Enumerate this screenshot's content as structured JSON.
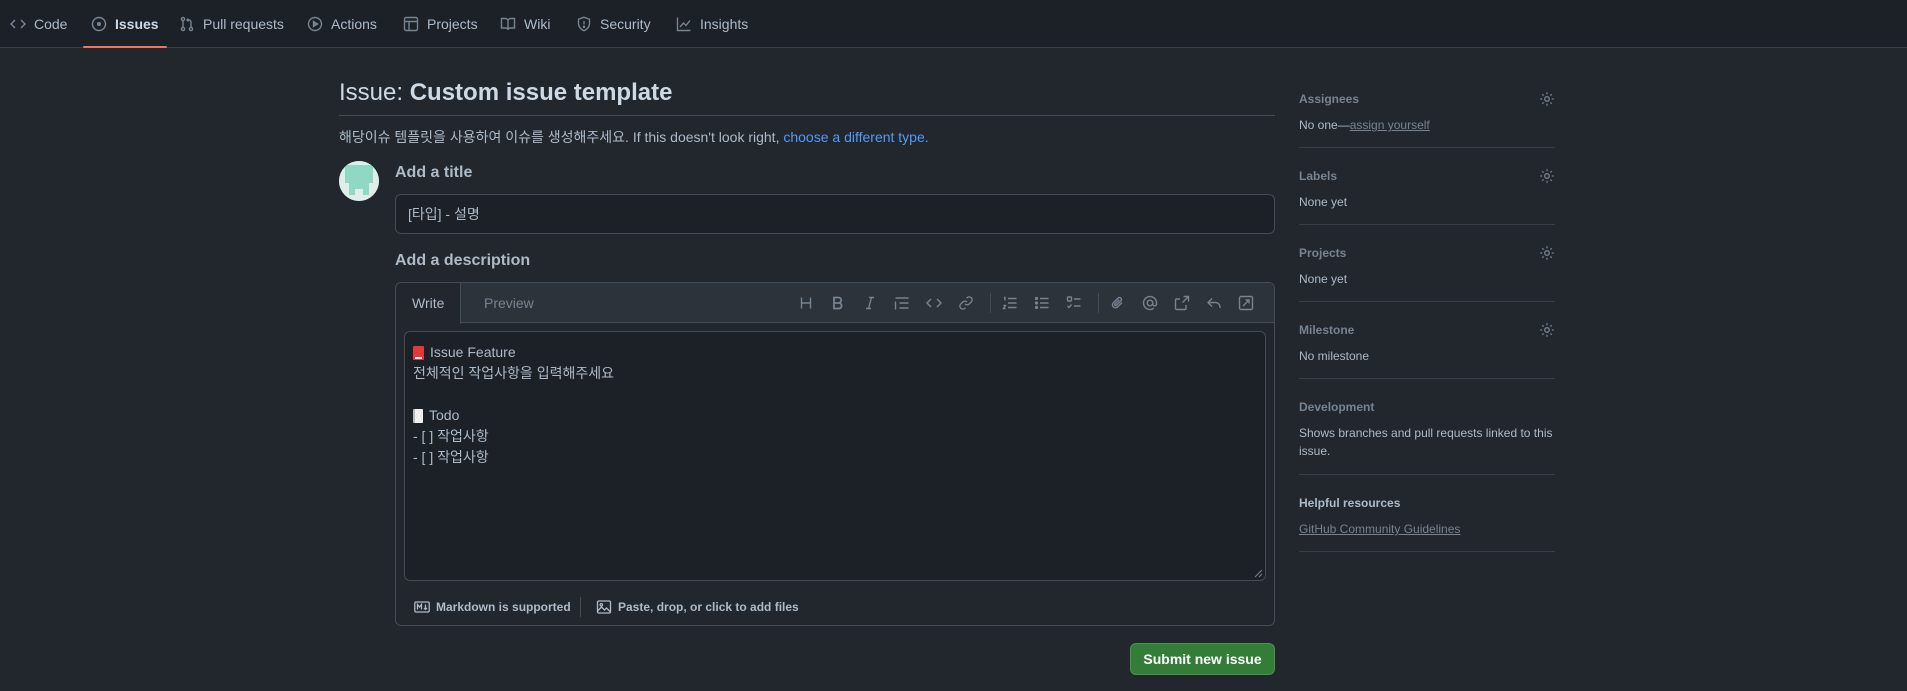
{
  "nav": {
    "tabs": [
      {
        "label": "Code",
        "icon": "code-icon"
      },
      {
        "label": "Issues",
        "icon": "issue-opened-icon",
        "active": true
      },
      {
        "label": "Pull requests",
        "icon": "git-pull-request-icon"
      },
      {
        "label": "Actions",
        "icon": "play-icon"
      },
      {
        "label": "Projects",
        "icon": "table-icon"
      },
      {
        "label": "Wiki",
        "icon": "book-icon"
      },
      {
        "label": "Security",
        "icon": "shield-icon"
      },
      {
        "label": "Insights",
        "icon": "graph-icon"
      }
    ],
    "active_underline_color": "#ec775c"
  },
  "page": {
    "title_prefix": "Issue: ",
    "title": "Custom issue template",
    "subtitle_text": "해당이슈 템플릿을 사용하여 이슈를 생성해주세요. If this doesn't look right, ",
    "subtitle_link": "choose a different type."
  },
  "form": {
    "title_label": "Add a title",
    "title_value": "[타입] - 설명",
    "description_label": "Add a description",
    "write_tab": "Write",
    "preview_tab": "Preview",
    "body_lines": [
      {
        "emoji": "book",
        "text": "Issue Feature"
      },
      {
        "emoji": "",
        "text": "전체적인 작업사항을 입력해주세요"
      },
      {
        "emoji": "",
        "text": ""
      },
      {
        "emoji": "page",
        "text": "Todo"
      },
      {
        "emoji": "",
        "text": "- [ ] 작업사항"
      },
      {
        "emoji": "",
        "text": "- [ ] 작업사항"
      }
    ],
    "markdown_note": "Markdown is supported",
    "attach_note": "Paste, drop, or click to add files",
    "submit_label": "Submit new issue",
    "submit_color": "#347d39"
  },
  "sidebar": {
    "assignees": {
      "heading": "Assignees",
      "value": "No one—",
      "link": "assign yourself"
    },
    "labels": {
      "heading": "Labels",
      "value": "None yet"
    },
    "projects": {
      "heading": "Projects",
      "value": "None yet"
    },
    "milestone": {
      "heading": "Milestone",
      "value": "No milestone"
    },
    "development": {
      "heading": "Development",
      "value": "Shows branches and pull requests linked to this issue."
    },
    "resources": {
      "heading": "Helpful resources",
      "link": "GitHub Community Guidelines"
    }
  }
}
